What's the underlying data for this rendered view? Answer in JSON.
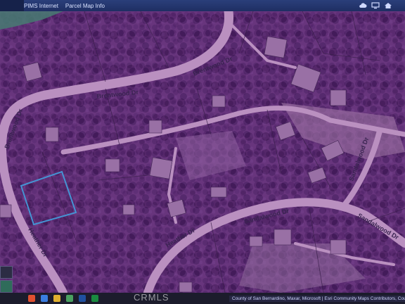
{
  "menu": {
    "item1": "PIMS Internet",
    "item2": "Parcel Map Info"
  },
  "roads": {
    "brentwood_upper": "Brentwood Dr",
    "brentwood_mid": "Brentwood Dr",
    "brentwood_left": "Brentwood Dr",
    "sandalwood": "Sandalwood Dr",
    "sandalwood_right": "Sandalwood Dr",
    "sandalwood_far_right": "Sandalwood Dr",
    "lower_left_road": "Heather Dr",
    "lower_mid_road": "Heather Dr"
  },
  "attribution": "County of San Bernardino, Maxar, Microsoft | Esri Community Maps Contributors, County",
  "watermark": "CRMLS",
  "icons": [
    "cloud-icon",
    "screen-icon",
    "home-icon"
  ],
  "colors": {
    "tint": "#7a3f9a",
    "parcel_outline": "#3aa7e0",
    "topbar": "#1f2f63"
  }
}
